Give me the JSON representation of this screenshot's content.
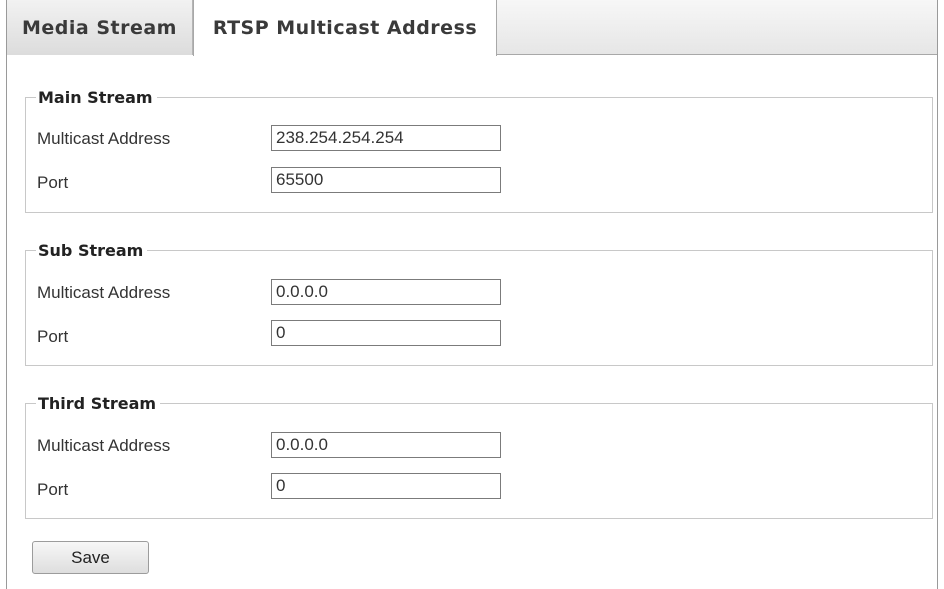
{
  "tabs": [
    {
      "label": "Media Stream",
      "active": false
    },
    {
      "label": "RTSP Multicast Address",
      "active": true
    }
  ],
  "main_stream": {
    "title": "Main Stream",
    "address_label": "Multicast Address",
    "address_value": "238.254.254.254",
    "port_label": "Port",
    "port_value": "65500"
  },
  "sub_stream": {
    "title": "Sub Stream",
    "address_label": "Multicast Address",
    "address_value": "0.0.0.0",
    "port_label": "Port",
    "port_value": "0"
  },
  "third_stream": {
    "title": "Third Stream",
    "address_label": "Multicast Address",
    "address_value": "0.0.0.0",
    "port_label": "Port",
    "port_value": "0"
  },
  "save_label": "Save"
}
